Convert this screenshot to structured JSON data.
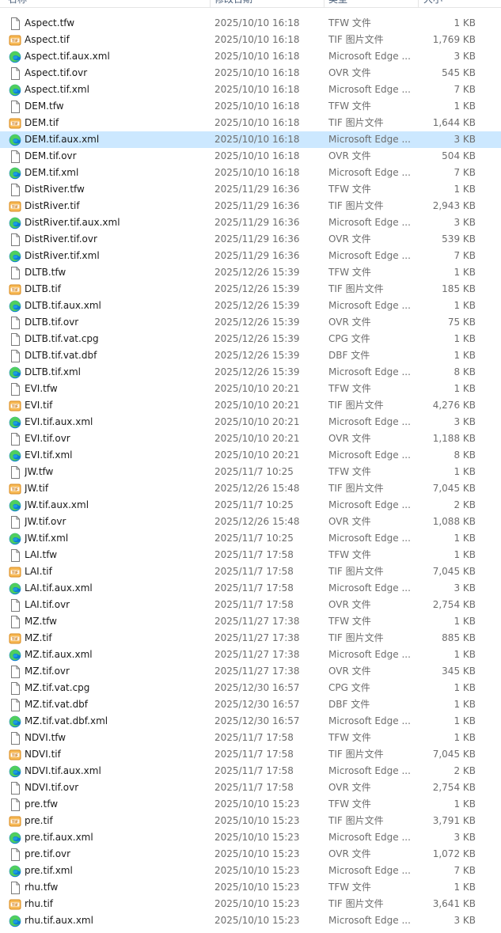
{
  "columns": {
    "name": "名称",
    "date": "修改日期",
    "type": "类型",
    "size": "大小"
  },
  "files": [
    {
      "name": "Aspect.tfw",
      "date": "2025/10/10 16:18",
      "type": "TFW 文件",
      "size": "1 KB",
      "icon": "file-icon"
    },
    {
      "name": "Aspect.tif",
      "date": "2025/10/10 16:18",
      "type": "TIF 图片文件",
      "size": "1,769 KB",
      "icon": "tif-image-icon"
    },
    {
      "name": "Aspect.tif.aux.xml",
      "date": "2025/10/10 16:18",
      "type": "Microsoft Edge ...",
      "size": "3 KB",
      "icon": "edge-icon"
    },
    {
      "name": "Aspect.tif.ovr",
      "date": "2025/10/10 16:18",
      "type": "OVR 文件",
      "size": "545 KB",
      "icon": "file-icon"
    },
    {
      "name": "Aspect.tif.xml",
      "date": "2025/10/10 16:18",
      "type": "Microsoft Edge ...",
      "size": "7 KB",
      "icon": "edge-icon"
    },
    {
      "name": "DEM.tfw",
      "date": "2025/10/10 16:18",
      "type": "TFW 文件",
      "size": "1 KB",
      "icon": "file-icon"
    },
    {
      "name": "DEM.tif",
      "date": "2025/10/10 16:18",
      "type": "TIF 图片文件",
      "size": "1,644 KB",
      "icon": "tif-image-icon"
    },
    {
      "name": "DEM.tif.aux.xml",
      "date": "2025/10/10 16:18",
      "type": "Microsoft Edge ...",
      "size": "3 KB",
      "icon": "edge-icon",
      "state": "selected"
    },
    {
      "name": "DEM.tif.ovr",
      "date": "2025/10/10 16:18",
      "type": "OVR 文件",
      "size": "504 KB",
      "icon": "file-icon"
    },
    {
      "name": "DEM.tif.xml",
      "date": "2025/10/10 16:18",
      "type": "Microsoft Edge ...",
      "size": "7 KB",
      "icon": "edge-icon"
    },
    {
      "name": "DistRiver.tfw",
      "date": "2025/11/29 16:36",
      "type": "TFW 文件",
      "size": "1 KB",
      "icon": "file-icon"
    },
    {
      "name": "DistRiver.tif",
      "date": "2025/11/29 16:36",
      "type": "TIF 图片文件",
      "size": "2,943 KB",
      "icon": "tif-image-icon"
    },
    {
      "name": "DistRiver.tif.aux.xml",
      "date": "2025/11/29 16:36",
      "type": "Microsoft Edge ...",
      "size": "3 KB",
      "icon": "edge-icon"
    },
    {
      "name": "DistRiver.tif.ovr",
      "date": "2025/11/29 16:36",
      "type": "OVR 文件",
      "size": "539 KB",
      "icon": "file-icon"
    },
    {
      "name": "DistRiver.tif.xml",
      "date": "2025/11/29 16:36",
      "type": "Microsoft Edge ...",
      "size": "7 KB",
      "icon": "edge-icon"
    },
    {
      "name": "DLTB.tfw",
      "date": "2025/12/26 15:39",
      "type": "TFW 文件",
      "size": "1 KB",
      "icon": "file-icon"
    },
    {
      "name": "DLTB.tif",
      "date": "2025/12/26 15:39",
      "type": "TIF 图片文件",
      "size": "185 KB",
      "icon": "tif-image-icon"
    },
    {
      "name": "DLTB.tif.aux.xml",
      "date": "2025/12/26 15:39",
      "type": "Microsoft Edge ...",
      "size": "1 KB",
      "icon": "edge-icon"
    },
    {
      "name": "DLTB.tif.ovr",
      "date": "2025/12/26 15:39",
      "type": "OVR 文件",
      "size": "75 KB",
      "icon": "file-icon"
    },
    {
      "name": "DLTB.tif.vat.cpg",
      "date": "2025/12/26 15:39",
      "type": "CPG 文件",
      "size": "1 KB",
      "icon": "file-icon"
    },
    {
      "name": "DLTB.tif.vat.dbf",
      "date": "2025/12/26 15:39",
      "type": "DBF 文件",
      "size": "1 KB",
      "icon": "file-icon"
    },
    {
      "name": "DLTB.tif.xml",
      "date": "2025/12/26 15:39",
      "type": "Microsoft Edge ...",
      "size": "8 KB",
      "icon": "edge-icon"
    },
    {
      "name": "EVI.tfw",
      "date": "2025/10/10 20:21",
      "type": "TFW 文件",
      "size": "1 KB",
      "icon": "file-icon"
    },
    {
      "name": "EVI.tif",
      "date": "2025/10/10 20:21",
      "type": "TIF 图片文件",
      "size": "4,276 KB",
      "icon": "tif-image-icon"
    },
    {
      "name": "EVI.tif.aux.xml",
      "date": "2025/10/10 20:21",
      "type": "Microsoft Edge ...",
      "size": "3 KB",
      "icon": "edge-icon"
    },
    {
      "name": "EVI.tif.ovr",
      "date": "2025/10/10 20:21",
      "type": "OVR 文件",
      "size": "1,188 KB",
      "icon": "file-icon"
    },
    {
      "name": "EVI.tif.xml",
      "date": "2025/10/10 20:21",
      "type": "Microsoft Edge ...",
      "size": "8 KB",
      "icon": "edge-icon"
    },
    {
      "name": "JW.tfw",
      "date": "2025/11/7 10:25",
      "type": "TFW 文件",
      "size": "1 KB",
      "icon": "file-icon"
    },
    {
      "name": "JW.tif",
      "date": "2025/12/26 15:48",
      "type": "TIF 图片文件",
      "size": "7,045 KB",
      "icon": "tif-image-icon"
    },
    {
      "name": "JW.tif.aux.xml",
      "date": "2025/11/7 10:25",
      "type": "Microsoft Edge ...",
      "size": "2 KB",
      "icon": "edge-icon"
    },
    {
      "name": "JW.tif.ovr",
      "date": "2025/12/26 15:48",
      "type": "OVR 文件",
      "size": "1,088 KB",
      "icon": "file-icon"
    },
    {
      "name": "JW.tif.xml",
      "date": "2025/11/7 10:25",
      "type": "Microsoft Edge ...",
      "size": "1 KB",
      "icon": "edge-icon"
    },
    {
      "name": "LAI.tfw",
      "date": "2025/11/7 17:58",
      "type": "TFW 文件",
      "size": "1 KB",
      "icon": "file-icon"
    },
    {
      "name": "LAI.tif",
      "date": "2025/11/7 17:58",
      "type": "TIF 图片文件",
      "size": "7,045 KB",
      "icon": "tif-image-icon"
    },
    {
      "name": "LAI.tif.aux.xml",
      "date": "2025/11/7 17:58",
      "type": "Microsoft Edge ...",
      "size": "3 KB",
      "icon": "edge-icon"
    },
    {
      "name": "LAI.tif.ovr",
      "date": "2025/11/7 17:58",
      "type": "OVR 文件",
      "size": "2,754 KB",
      "icon": "file-icon"
    },
    {
      "name": "MZ.tfw",
      "date": "2025/11/27 17:38",
      "type": "TFW 文件",
      "size": "1 KB",
      "icon": "file-icon"
    },
    {
      "name": "MZ.tif",
      "date": "2025/11/27 17:38",
      "type": "TIF 图片文件",
      "size": "885 KB",
      "icon": "tif-image-icon"
    },
    {
      "name": "MZ.tif.aux.xml",
      "date": "2025/11/27 17:38",
      "type": "Microsoft Edge ...",
      "size": "1 KB",
      "icon": "edge-icon"
    },
    {
      "name": "MZ.tif.ovr",
      "date": "2025/11/27 17:38",
      "type": "OVR 文件",
      "size": "345 KB",
      "icon": "file-icon"
    },
    {
      "name": "MZ.tif.vat.cpg",
      "date": "2025/12/30 16:57",
      "type": "CPG 文件",
      "size": "1 KB",
      "icon": "file-icon"
    },
    {
      "name": "MZ.tif.vat.dbf",
      "date": "2025/12/30 16:57",
      "type": "DBF 文件",
      "size": "1 KB",
      "icon": "file-icon"
    },
    {
      "name": "MZ.tif.vat.dbf.xml",
      "date": "2025/12/30 16:57",
      "type": "Microsoft Edge ...",
      "size": "1 KB",
      "icon": "edge-icon"
    },
    {
      "name": "NDVI.tfw",
      "date": "2025/11/7 17:58",
      "type": "TFW 文件",
      "size": "1 KB",
      "icon": "file-icon"
    },
    {
      "name": "NDVI.tif",
      "date": "2025/11/7 17:58",
      "type": "TIF 图片文件",
      "size": "7,045 KB",
      "icon": "tif-image-icon"
    },
    {
      "name": "NDVI.tif.aux.xml",
      "date": "2025/11/7 17:58",
      "type": "Microsoft Edge ...",
      "size": "2 KB",
      "icon": "edge-icon"
    },
    {
      "name": "NDVI.tif.ovr",
      "date": "2025/11/7 17:58",
      "type": "OVR 文件",
      "size": "2,754 KB",
      "icon": "file-icon"
    },
    {
      "name": "pre.tfw",
      "date": "2025/10/10 15:23",
      "type": "TFW 文件",
      "size": "1 KB",
      "icon": "file-icon"
    },
    {
      "name": "pre.tif",
      "date": "2025/10/10 15:23",
      "type": "TIF 图片文件",
      "size": "3,791 KB",
      "icon": "tif-image-icon"
    },
    {
      "name": "pre.tif.aux.xml",
      "date": "2025/10/10 15:23",
      "type": "Microsoft Edge ...",
      "size": "3 KB",
      "icon": "edge-icon"
    },
    {
      "name": "pre.tif.ovr",
      "date": "2025/10/10 15:23",
      "type": "OVR 文件",
      "size": "1,072 KB",
      "icon": "file-icon"
    },
    {
      "name": "pre.tif.xml",
      "date": "2025/10/10 15:23",
      "type": "Microsoft Edge ...",
      "size": "7 KB",
      "icon": "edge-icon"
    },
    {
      "name": "rhu.tfw",
      "date": "2025/10/10 15:23",
      "type": "TFW 文件",
      "size": "1 KB",
      "icon": "file-icon"
    },
    {
      "name": "rhu.tif",
      "date": "2025/10/10 15:23",
      "type": "TIF 图片文件",
      "size": "3,641 KB",
      "icon": "tif-image-icon"
    },
    {
      "name": "rhu.tif.aux.xml",
      "date": "2025/10/10 15:23",
      "type": "Microsoft Edge ...",
      "size": "3 KB",
      "icon": "edge-icon"
    }
  ],
  "colors": {
    "selected_row": "#cce8ff",
    "edge_blue": "#0c7bd6",
    "edge_green": "#4fcf5e",
    "tif_orange": "#f3a83b"
  }
}
